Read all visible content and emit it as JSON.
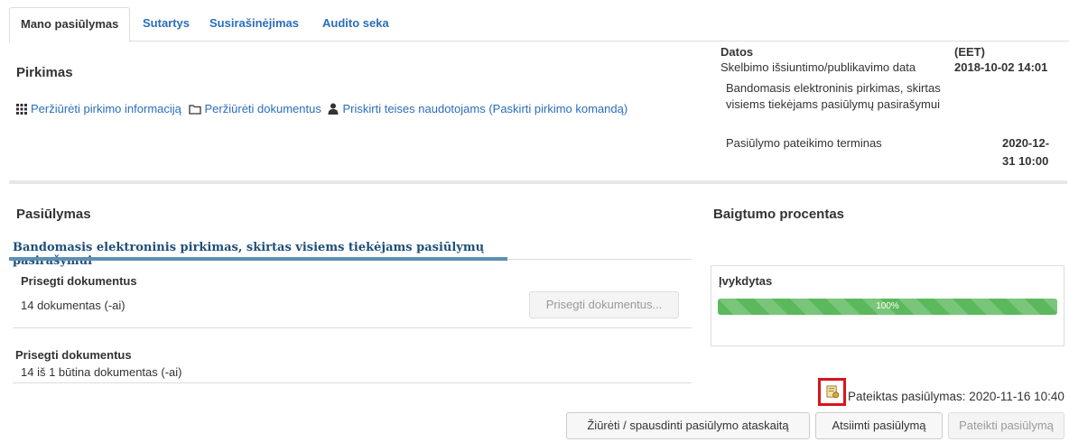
{
  "tabs": [
    {
      "label": "Mano pasiūlymas"
    },
    {
      "label": "Sutartys"
    },
    {
      "label": "Susirašinėjimas"
    },
    {
      "label": "Audito seka"
    }
  ],
  "purchase": {
    "title": "Pirkimas",
    "links": [
      {
        "icon": "grid-icon",
        "label": "Peržiūrėti pirkimo informaciją"
      },
      {
        "icon": "folder-icon",
        "label": "Peržiūrėti dokumentus"
      },
      {
        "icon": "user-icon",
        "label": "Priskirti teises naudotojams (Paskirti pirkimo komandą)"
      }
    ]
  },
  "dates": {
    "header": "Datos",
    "timezone": "(EET)",
    "publish_label": "Skelbimo išsiuntimo/publikavimo data",
    "publish_value": "2018-10-02 14:01",
    "procurement_line1": "Bandomasis elektroninis pirkimas, skirtas",
    "procurement_line2": "visiems tiekėjams pasiūlymų pasirašymui",
    "deadline_label": "Pasiūlymo pateikimo terminas",
    "deadline_line1": "2020-12-",
    "deadline_line2": "31 10:00"
  },
  "offer": {
    "title": "Pasiūlymas",
    "procurement_name": "Bandomasis elektroninis pirkimas, skirtas visiems tiekėjams pasiūlymų pasirašymui",
    "attach_label": "Prisegti dokumentus",
    "attach_count": "14  dokumentas (-ai)",
    "attach_button": "Prisegti dokumentus...",
    "required_label": "Prisegti dokumentus",
    "required_count": "14  iš 1 būtina dokumentas (-ai)"
  },
  "completion": {
    "title": "Baigtumo procentas",
    "done_label": "Įvykdytas",
    "percent_text": "100%",
    "percent_value": 100
  },
  "submitted": {
    "text": "Pateiktas pasiūlymas: 2020-11-16 10:40",
    "icon": "document-stamp-icon"
  },
  "actions": {
    "report": "Žiūrėti / spausdinti pasiūlymo ataskaitą",
    "withdraw": "Atsiimti pasiūlymą",
    "submit": "Pateikti pasiūlymą"
  },
  "colors": {
    "link": "#2a6ebb",
    "progress": "#5cb85c",
    "highlight_box": "#d9141b"
  }
}
